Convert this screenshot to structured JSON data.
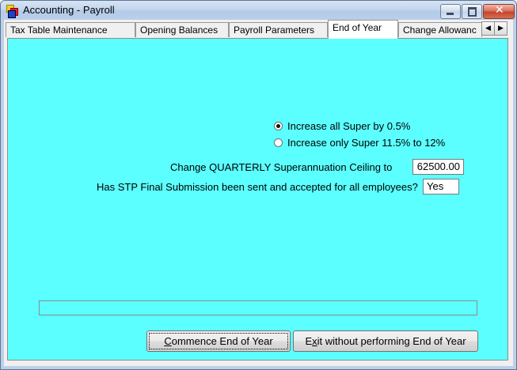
{
  "window": {
    "title": "Accounting - Payroll",
    "close_glyph": "✕"
  },
  "tabs": [
    {
      "label": "Tax Table Maintenance",
      "active": false
    },
    {
      "label": "Opening Balances",
      "active": false
    },
    {
      "label": "Payroll Parameters",
      "active": false
    },
    {
      "label": "End of Year",
      "active": true
    },
    {
      "label": "Change Allowanc",
      "active": false
    }
  ],
  "tab_scroll": {
    "left": "◀",
    "right": "▶"
  },
  "end_of_year": {
    "super_options": [
      {
        "label": "Increase all Super by 0.5%",
        "selected": true
      },
      {
        "label": "Increase only Super 11.5% to 12%",
        "selected": false
      }
    ],
    "ceiling_label": "Change QUARTERLY Superannuation Ceiling to",
    "ceiling_value": "62500.00",
    "stp_label": "Has STP Final Submission been sent and accepted for all employees?",
    "stp_value": "Yes",
    "progress": 0
  },
  "buttons": {
    "commence_prefix": "",
    "commence_mnemonic": "C",
    "commence_rest": "ommence End of Year",
    "exit_prefix": "E",
    "exit_mnemonic": "x",
    "exit_rest": "it without performing End of Year"
  },
  "colors": {
    "panel_background": "#5cffff"
  }
}
